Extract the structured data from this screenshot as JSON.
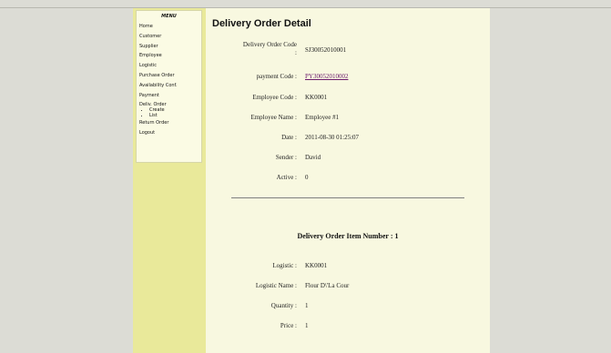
{
  "menu": {
    "title": "MENU",
    "items": [
      {
        "label": "Home"
      },
      {
        "label": "Customer"
      },
      {
        "label": "Supplier"
      },
      {
        "label": "Employee"
      },
      {
        "label": "Logistic"
      },
      {
        "label": "Purchase Order"
      },
      {
        "label": "Availability Conf."
      },
      {
        "label": "Payment"
      },
      {
        "label": "Deliv. Order"
      },
      {
        "label": "Return Order"
      },
      {
        "label": "Logout"
      }
    ],
    "deliv_sub": [
      {
        "label": "Create"
      },
      {
        "label": "List"
      }
    ]
  },
  "page": {
    "title": "Delivery Order Detail"
  },
  "detail": {
    "delivery_order_code_label_line1": "Delivery Order Code",
    "delivery_order_code_label_line2": ":",
    "delivery_order_code": "SJ30052010001",
    "payment_code_label": "payment Code :",
    "payment_code": "PY30052010002",
    "employee_code_label": "Employee Code :",
    "employee_code": "KK0001",
    "employee_name_label": "Employee Name :",
    "employee_name": "Employee #1",
    "date_label": "Date :",
    "date": "2011-08-30 01:25:07",
    "sender_label": "Sender :",
    "sender": "David",
    "active_label": "Active :",
    "active": "0"
  },
  "item": {
    "section_title": "Delivery Order Item Number : 1",
    "logistic_label": "Logistic :",
    "logistic": "KK0001",
    "logistic_name_label": "Logistic Name :",
    "logistic_name": "Flour D\\'La Cour",
    "quantity_label": "Quantity :",
    "quantity": "1",
    "price_label": "Price :",
    "price": "1"
  }
}
